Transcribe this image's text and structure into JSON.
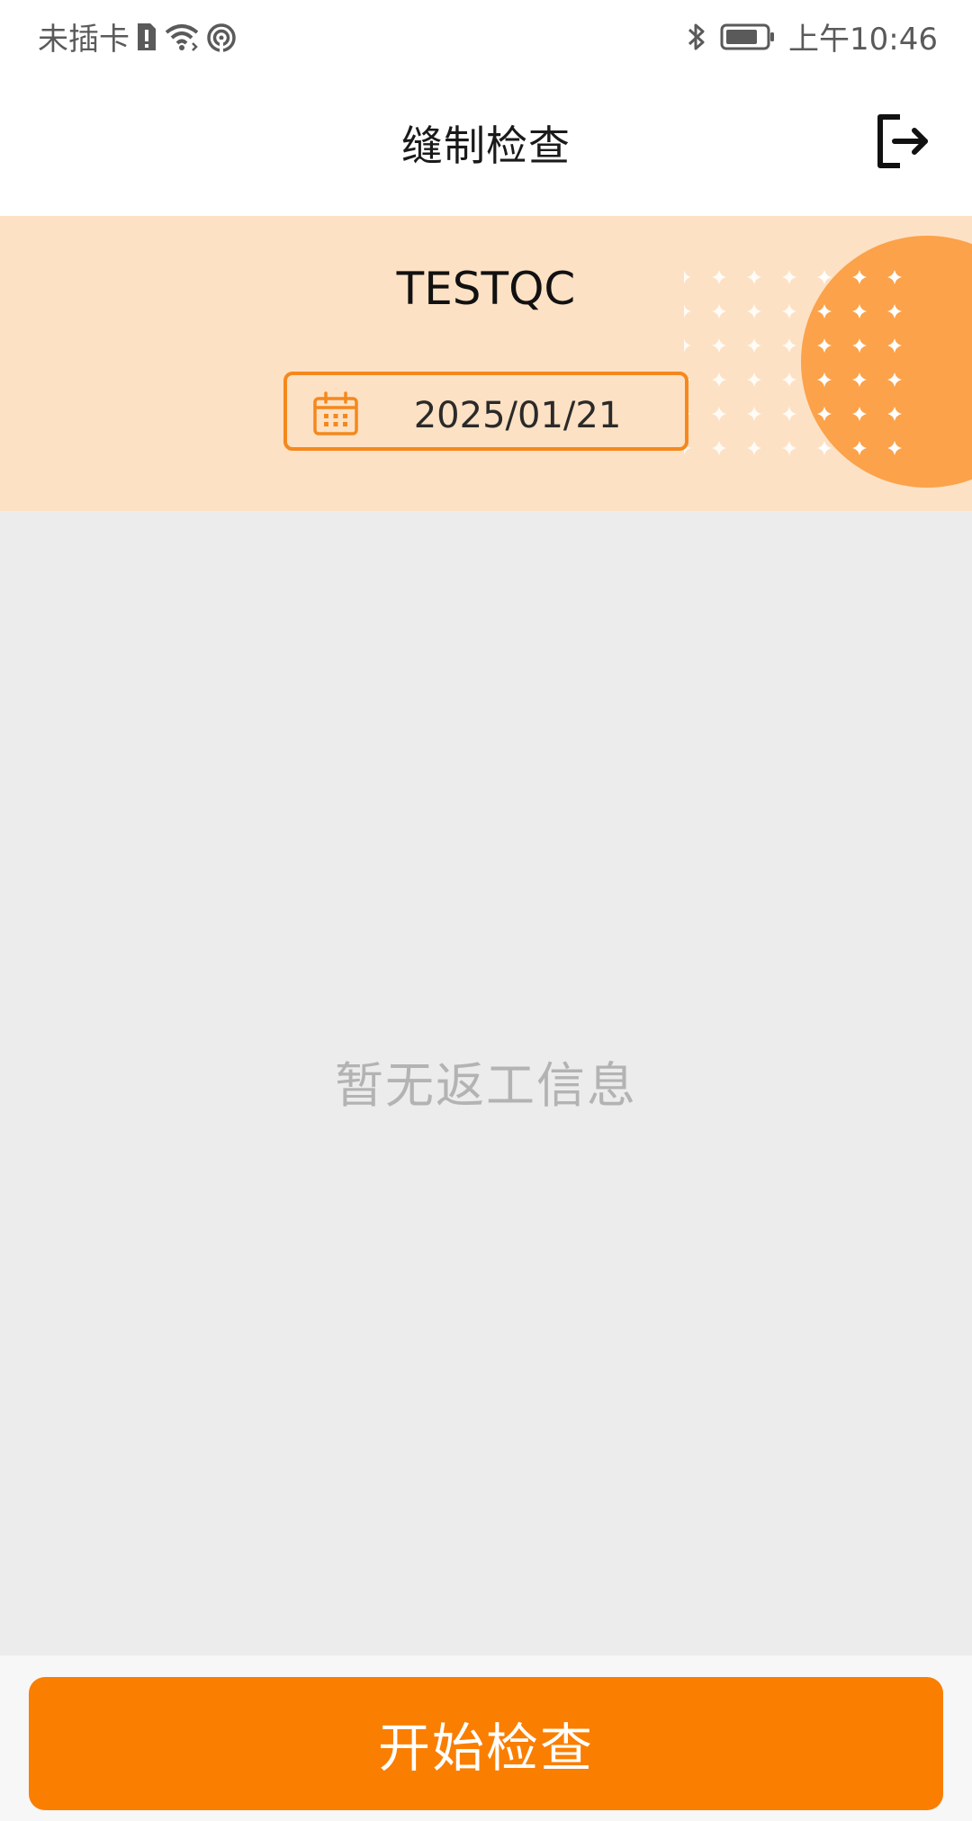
{
  "status_bar": {
    "carrier": "未插卡",
    "time": "上午10:46",
    "icons": [
      "sim-alert-icon",
      "wifi-icon",
      "hotspot-icon",
      "bluetooth-icon",
      "battery-icon"
    ]
  },
  "header": {
    "title": "缝制检查",
    "logout_icon": "logout-icon"
  },
  "banner": {
    "user": "TESTQC",
    "date": "2025/01/21",
    "calendar_icon": "calendar-icon"
  },
  "content": {
    "empty_message": "暂无返工信息"
  },
  "footer": {
    "start_button": "开始检查"
  },
  "colors": {
    "accent": "#fa7e00",
    "banner_bg": "#fde1c4",
    "date_border": "#f5881d",
    "page_bg": "#ececec"
  }
}
